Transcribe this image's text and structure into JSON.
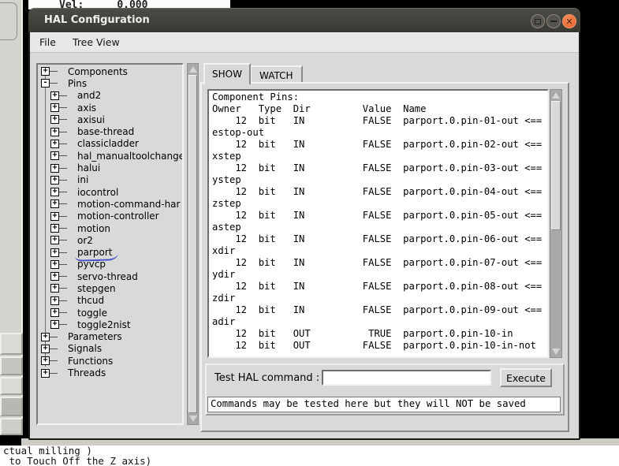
{
  "background": {
    "vel_label": "Vel:",
    "vel_value": "0.000",
    "console_lines": [
      "ctual milling )",
      " to Touch Off the Z axis)"
    ]
  },
  "window": {
    "title": "HAL Configuration",
    "window_buttons": [
      "maximize",
      "minimize",
      "close"
    ],
    "menu": [
      "File",
      "Tree View"
    ],
    "tabs": [
      {
        "label": "SHOW",
        "active": true
      },
      {
        "label": "WATCH",
        "active": false
      }
    ],
    "tree": {
      "items": [
        {
          "label": "Components",
          "level": 0,
          "expanded": false,
          "underlined": false
        },
        {
          "label": "Pins",
          "level": 0,
          "expanded": true,
          "underlined": false
        },
        {
          "label": "and2",
          "level": 1,
          "expanded": false,
          "underlined": false
        },
        {
          "label": "axis",
          "level": 1,
          "expanded": false,
          "underlined": false
        },
        {
          "label": "axisui",
          "level": 1,
          "expanded": false,
          "underlined": false
        },
        {
          "label": "base-thread",
          "level": 1,
          "expanded": false,
          "underlined": false
        },
        {
          "label": "classicladder",
          "level": 1,
          "expanded": false,
          "underlined": false
        },
        {
          "label": "hal_manualtoolchange",
          "level": 1,
          "expanded": false,
          "underlined": false
        },
        {
          "label": "halui",
          "level": 1,
          "expanded": false,
          "underlined": false
        },
        {
          "label": "ini",
          "level": 1,
          "expanded": false,
          "underlined": false
        },
        {
          "label": "iocontrol",
          "level": 1,
          "expanded": false,
          "underlined": false
        },
        {
          "label": "motion-command-har",
          "level": 1,
          "expanded": false,
          "underlined": false
        },
        {
          "label": "motion-controller",
          "level": 1,
          "expanded": false,
          "underlined": false
        },
        {
          "label": "motion",
          "level": 1,
          "expanded": false,
          "underlined": false
        },
        {
          "label": "or2",
          "level": 1,
          "expanded": false,
          "underlined": false
        },
        {
          "label": "parport",
          "level": 1,
          "expanded": false,
          "underlined": true
        },
        {
          "label": "pyvcp",
          "level": 1,
          "expanded": false,
          "underlined": false
        },
        {
          "label": "servo-thread",
          "level": 1,
          "expanded": false,
          "underlined": false
        },
        {
          "label": "stepgen",
          "level": 1,
          "expanded": false,
          "underlined": false
        },
        {
          "label": "thcud",
          "level": 1,
          "expanded": false,
          "underlined": false
        },
        {
          "label": "toggle",
          "level": 1,
          "expanded": false,
          "underlined": false
        },
        {
          "label": "toggle2nist",
          "level": 1,
          "expanded": false,
          "underlined": false
        },
        {
          "label": "Parameters",
          "level": 0,
          "expanded": false,
          "underlined": false
        },
        {
          "label": "Signals",
          "level": 0,
          "expanded": false,
          "underlined": false
        },
        {
          "label": "Functions",
          "level": 0,
          "expanded": false,
          "underlined": false
        },
        {
          "label": "Threads",
          "level": 0,
          "expanded": false,
          "underlined": false
        }
      ]
    },
    "output": {
      "lines": [
        "Component Pins:",
        "Owner   Type  Dir         Value  Name",
        "    12  bit   IN          FALSE  parport.0.pin-01-out <==",
        "estop-out",
        "    12  bit   IN          FALSE  parport.0.pin-02-out <==",
        "xstep",
        "    12  bit   IN          FALSE  parport.0.pin-03-out <==",
        "ystep",
        "    12  bit   IN          FALSE  parport.0.pin-04-out <==",
        "zstep",
        "    12  bit   IN          FALSE  parport.0.pin-05-out <==",
        "astep",
        "    12  bit   IN          FALSE  parport.0.pin-06-out <==",
        "xdir",
        "    12  bit   IN          FALSE  parport.0.pin-07-out <==",
        "ydir",
        "    12  bit   IN          FALSE  parport.0.pin-08-out <==",
        "zdir",
        "    12  bit   IN          FALSE  parport.0.pin-09-out <==",
        "adir",
        "    12  bit   OUT          TRUE  parport.0.pin-10-in",
        "    12  bit   OUT         FALSE  parport.0.pin-10-in-not"
      ]
    },
    "command": {
      "label": "Test HAL command :",
      "value": "",
      "execute_label": "Execute",
      "note": "Commands may be tested here but they will NOT be saved"
    }
  },
  "colors": {
    "titlebar": "#3c3b36",
    "close_button": "#e55f2c",
    "window_bg": "#d9d9d9",
    "underline_accent": "#4450cf",
    "desktop": "#000000"
  }
}
